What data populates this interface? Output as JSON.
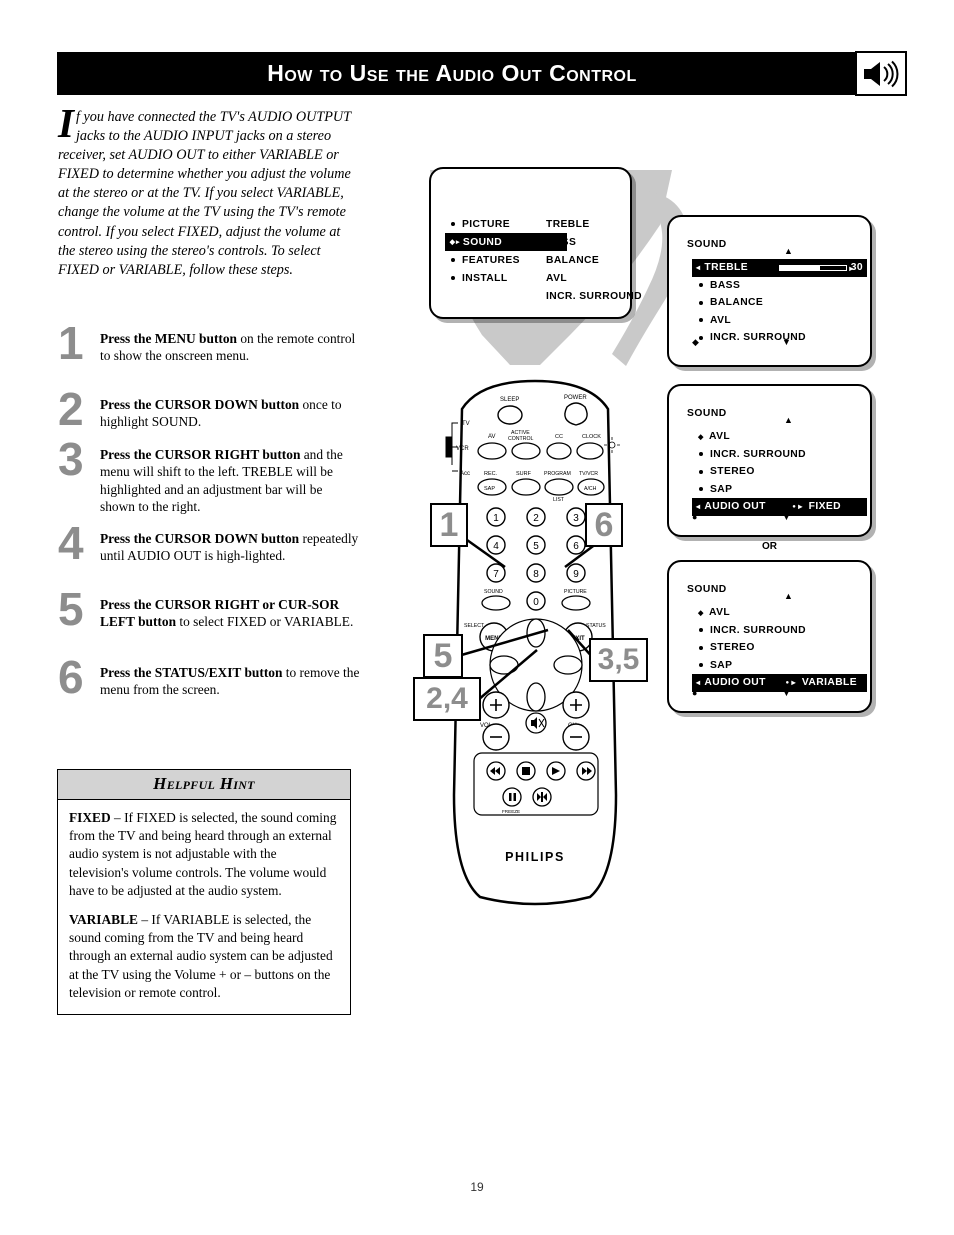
{
  "header": {
    "title": "How to Use the Audio Out Control",
    "icon": "speaker-icon"
  },
  "intro": {
    "dropcap": "I",
    "text": "f you have connected the TV's AUDIO OUTPUT jacks to the AUDIO INPUT jacks on a stereo receiver, set AUDIO OUT to either VARIABLE or FIXED to determine whether you adjust the volume at the stereo or at the TV.  If you select VARIABLE, change the volume at the TV using the TV's remote control.  If you select FIXED, adjust the volume at the stereo using the stereo's controls. To select FIXED or VARIABLE, follow these steps."
  },
  "steps": [
    {
      "num": "1",
      "bold": "Press the MENU button",
      "rest": " on the remote control to show the onscreen menu."
    },
    {
      "num": "2",
      "bold": "Press the CURSOR DOWN button",
      "rest": " once to highlight SOUND."
    },
    {
      "num": "3",
      "bold": "Press the CURSOR RIGHT button",
      "rest": " and the menu will shift to the left. TREBLE will be highlighted and an adjustment bar will be shown to the right."
    },
    {
      "num": "4",
      "bold": "Press the CURSOR DOWN button",
      "rest": " repeatedly until AUDIO OUT is high-lighted."
    },
    {
      "num": "5",
      "bold": "Press the CURSOR RIGHT or CUR-SOR LEFT button",
      "rest": " to select FIXED or VARIABLE."
    },
    {
      "num": "6",
      "bold": "Press the STATUS/EXIT button",
      "rest": " to remove the menu from the screen."
    }
  ],
  "hint": {
    "title": "Helpful Hint",
    "p1_bold": "FIXED",
    "p1": " – If FIXED is selected, the sound coming from the TV and being heard through an external audio system is not adjustable with the television's volume controls. The volume would have to be adjusted at the audio system.",
    "p2_bold": "VARIABLE",
    "p2": " – If VARIABLE is selected, the sound coming from the TV and being heard through an external audio system can be adjusted at the TV using the Volume + or – buttons on the television or remote control."
  },
  "menu_main": {
    "left": [
      {
        "label": "PICTURE",
        "highlighted": false
      },
      {
        "label": "SOUND",
        "highlighted": true
      },
      {
        "label": "FEATURES",
        "highlighted": false
      },
      {
        "label": "INSTALL",
        "highlighted": false
      }
    ],
    "right": [
      "TREBLE",
      "BASS",
      "BALANCE",
      "AVL",
      "INCR.  SURROUND"
    ]
  },
  "menu_sound_1": {
    "title": "SOUND",
    "items": [
      {
        "label": "TREBLE",
        "highlighted": true,
        "value": "30",
        "bar_percent": 60
      },
      {
        "label": "BASS",
        "highlighted": false
      },
      {
        "label": "BALANCE",
        "highlighted": false
      },
      {
        "label": "AVL",
        "highlighted": false
      },
      {
        "label": "INCR.  SURROUND",
        "highlighted": false
      }
    ]
  },
  "menu_sound_2": {
    "title": "SOUND",
    "items": [
      {
        "label": "AVL",
        "highlighted": false
      },
      {
        "label": "INCR.  SURROUND",
        "highlighted": false
      },
      {
        "label": "STEREO",
        "highlighted": false
      },
      {
        "label": "SAP",
        "highlighted": false
      },
      {
        "label": "AUDIO OUT",
        "highlighted": true,
        "value": "FIXED"
      }
    ]
  },
  "or_label": "OR",
  "menu_sound_3": {
    "title": "SOUND",
    "items": [
      {
        "label": "AVL",
        "highlighted": false
      },
      {
        "label": "INCR.  SURROUND",
        "highlighted": false
      },
      {
        "label": "STEREO",
        "highlighted": false
      },
      {
        "label": "SAP",
        "highlighted": false
      },
      {
        "label": "AUDIO OUT",
        "highlighted": true,
        "value": "VARIABLE"
      }
    ]
  },
  "remote": {
    "brand": "PHILIPS",
    "labels": {
      "sleep": "SLEEP",
      "power": "POWER",
      "tv": "TV",
      "vcr": "VCR",
      "acc": "Acc",
      "av": "AV",
      "active_control": "ACTIVE CONTROL",
      "cc": "CC",
      "clock": "CLOCK",
      "rec_sap": "REC SAP",
      "surf": "SURF",
      "program_list": "PROGRAM LIST",
      "tv_vcr": "TV/VCR A/CH",
      "sound": "SOUND",
      "picture": "PICTURE",
      "select_menu": "SELECT MENU",
      "status_exit": "STATUS EXIT",
      "vol": "VOL",
      "ch": "CH",
      "freeze": "FREEZE"
    },
    "keypad": [
      "1",
      "2",
      "3",
      "4",
      "5",
      "6",
      "7",
      "8",
      "9",
      "0"
    ]
  },
  "callouts": [
    {
      "id": "callout-1",
      "label": "1"
    },
    {
      "id": "callout-6",
      "label": "6"
    },
    {
      "id": "callout-5",
      "label": "5"
    },
    {
      "id": "callout-3-5",
      "label": "3,5"
    },
    {
      "id": "callout-2-4",
      "label": "2,4"
    }
  ],
  "page_number": "19",
  "colors": {
    "header_bg": "#000000",
    "step_number": "#8d8d8d",
    "hint_header_bg": "#d3d3d3",
    "beam": "#c9c9c9"
  }
}
